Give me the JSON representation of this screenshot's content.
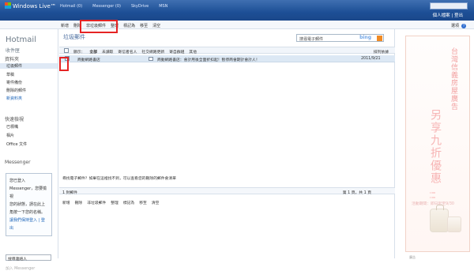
{
  "top": {
    "brand": "Windows Live™",
    "nav": [
      "Hotmail (0)",
      "Messenger (0)",
      "SkyDrive",
      "MSN"
    ],
    "user_links": "個人檔案 | 登出"
  },
  "toolbar": {
    "items": [
      "新增",
      "刪除",
      "非垃圾郵件",
      "整理",
      "標記為",
      "移至",
      "清空"
    ],
    "options": "選項",
    "help": "?"
  },
  "sidebar": {
    "title": "Hotmail",
    "subtitle": "收件匣",
    "folders_title": "資料夾",
    "folders": [
      "垃圾郵件",
      "草稿",
      "寄件備份",
      "刪除的郵件",
      "新資料夾"
    ],
    "quick_title": "快速檢視",
    "quick": [
      "已標幟",
      "相片",
      "Office 文件"
    ],
    "messenger_title": "Messenger",
    "messenger_box": [
      "您已登入",
      "Messenger，您要檢視",
      "您的狀態，請在此上",
      "角按一下您的名稱。",
      "讓我們保持登入 | 登出"
    ],
    "search_placeholder": "搜尋連絡人",
    "footer": "加入 Messenger"
  },
  "main": {
    "title": "垃圾郵件",
    "search_placeholder": "搜尋電子郵件",
    "bing": "bing",
    "filters": [
      "顯示：",
      "全部",
      "未讀取",
      "寄信者名人",
      "社交網路更新",
      "寄自群組",
      "其他"
    ],
    "sort": "排列依據",
    "email": {
      "sender": "商動網路書店",
      "subject": "商動網路書店：會計用後全面折扣起！暫停商會期計會計人！",
      "date": "2011/9/21"
    },
    "notice": "尋找電子郵件？如果在這裡找不到，可以查看您的刪除的郵件會清單",
    "count": "1 封郵件",
    "pager": "第 1 頁，共 1 頁",
    "bottom_items": [
      "新增",
      "刪除",
      "非垃圾郵件",
      "整理",
      "標記為",
      "移至",
      "清空"
    ]
  },
  "ad": {
    "line1": "台灣信義房屋廣告",
    "line2": "另享九折優惠",
    "line3": "!!",
    "small": "活動期間：即日起至9/30",
    "foot": "廣告"
  }
}
